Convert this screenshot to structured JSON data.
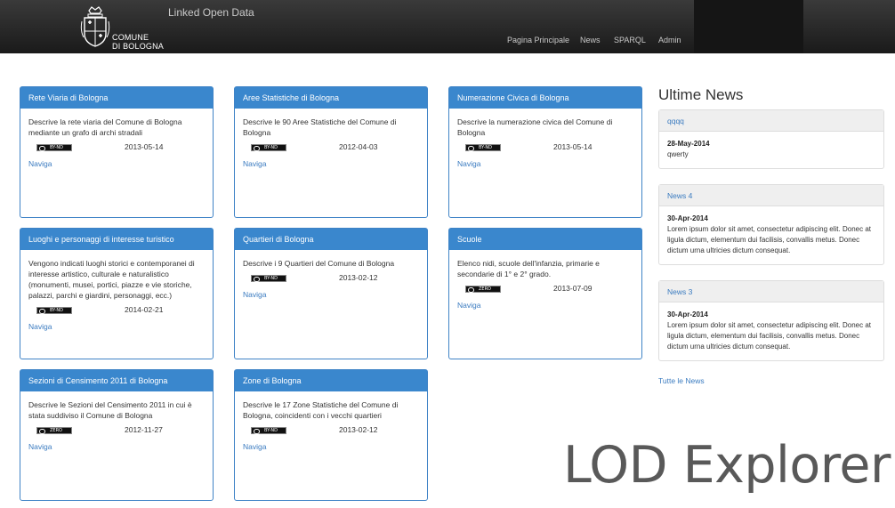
{
  "header": {
    "logo_line1": "COMUNE",
    "logo_line2": "DI BOLOGNA",
    "site_title": "Linked Open Data",
    "nav": [
      "Pagina Principale",
      "News",
      "SPARQL",
      "Admin"
    ]
  },
  "cards": [
    {
      "title": "Rete Viaria di Bologna",
      "description": "Descrive la rete viaria del Comune di Bologna mediante un grafo di archi stradali",
      "license": "BY-ND",
      "date": "2013-05-14",
      "link": "Naviga"
    },
    {
      "title": "Aree Statistiche di Bologna",
      "description": "Descrive le 90 Aree Statistiche del Comune di Bologna",
      "license": "BY-ND",
      "date": "2012-04-03",
      "link": "Naviga"
    },
    {
      "title": "Numerazione Civica di Bologna",
      "description": "Descrive la numerazione civica del Comune di Bologna",
      "license": "BY-ND",
      "date": "2013-05-14",
      "link": "Naviga"
    },
    {
      "title": "Luoghi e personaggi di interesse turistico",
      "description": "Vengono indicati luoghi storici e contemporanei di interesse artistico, culturale e naturalistico (monumenti, musei, portici, piazze e vie storiche, palazzi, parchi e giardini, personaggi, ecc.)",
      "license": "BY-ND",
      "date": "2014-02-21",
      "link": "Naviga"
    },
    {
      "title": "Quartieri di Bologna",
      "description": "Descrive i 9 Quartieri del Comune di Bologna",
      "license": "BY-ND",
      "date": "2013-02-12",
      "link": "Naviga"
    },
    {
      "title": "Scuole",
      "description": "Elenco nidi, scuole dell'infanzia, primarie e secondarie di 1° e 2° grado.",
      "license": "ZERO",
      "date": "2013-07-09",
      "link": "Naviga"
    },
    {
      "title": "Sezioni di Censimento 2011 di Bologna",
      "description": "Descrive le Sezioni del Censimento 2011 in cui è stata suddiviso il Comune di Bologna",
      "license": "ZERO",
      "date": "2012-11-27",
      "link": "Naviga"
    },
    {
      "title": "Zone di Bologna",
      "description": "Descrive le 17 Zone Statistiche del Comune di Bologna, coincidenti con i vecchi quartieri",
      "license": "BY-ND",
      "date": "2013-02-12",
      "link": "Naviga"
    }
  ],
  "news": {
    "heading": "Ultime News",
    "items": [
      {
        "title": "qqqq",
        "date": "28-May-2014",
        "body": "qwerty"
      },
      {
        "title": "News 4",
        "date": "30-Apr-2014",
        "body": "Lorem ipsum dolor sit amet, consectetur adipiscing elit. Donec at ligula dictum, elementum dui facilisis, convallis metus. Donec dictum urna ultricies dictum consequat."
      },
      {
        "title": "News 3",
        "date": "30-Apr-2014",
        "body": "Lorem ipsum dolor sit amet, consectetur adipiscing elit. Donec at ligula dictum, elementum dui facilisis, convallis metus. Donec dictum urna ultricies dictum consequat."
      }
    ],
    "all_link": "Tutte le News"
  },
  "watermark": "LOD Explorer"
}
